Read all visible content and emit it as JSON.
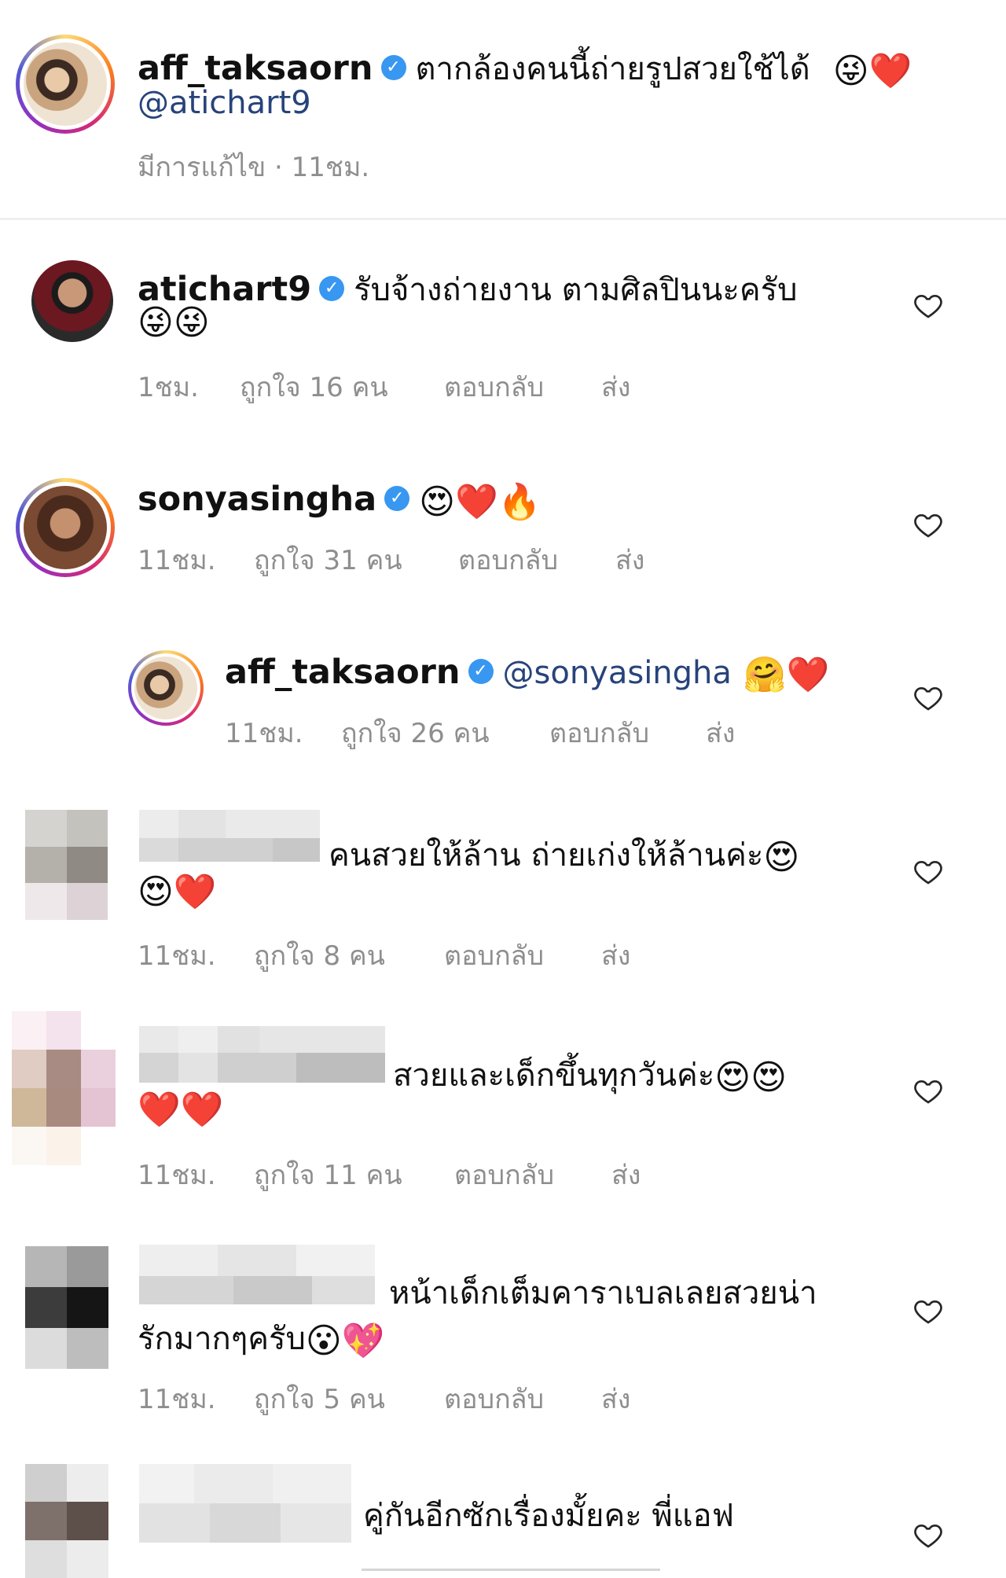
{
  "post": {
    "username": "aff_taksaorn",
    "caption": "ตากล้องคนนี้ถ่ายรูปสวยใช้ได้",
    "caption_emoji": "😜❤️",
    "mention": "@atichart9",
    "meta": "มีการแก้ไข · 11ชม."
  },
  "comments": [
    {
      "username": "atichart9",
      "text": "รับจ้างถ่ายงาน ตามศิลปินนะครับ",
      "emoji_line2": "😜😜",
      "time": "1ชม.",
      "likes": "ถูกใจ 16 คน",
      "reply": "ตอบกลับ",
      "send": "ส่ง"
    },
    {
      "username": "sonyasingha",
      "emoji": "😍❤️🔥",
      "time": "11ชม.",
      "likes": "ถูกใจ 31 คน",
      "reply": "ตอบกลับ",
      "send": "ส่ง"
    },
    {
      "username": "aff_taksaorn",
      "mention": "@sonyasingha",
      "emoji": "🤗❤️",
      "time": "11ชม.",
      "likes": "ถูกใจ 26 คน",
      "reply": "ตอบกลับ",
      "send": "ส่ง"
    },
    {
      "text": "คนสวยให้ล้าน ถ่ายเก่งให้ล้านค่ะ",
      "emoji_end": "😍",
      "emoji_line2": "😍❤️",
      "time": "11ชม.",
      "likes": "ถูกใจ 8 คน",
      "reply": "ตอบกลับ",
      "send": "ส่ง"
    },
    {
      "text": "สวยและเด็กขึ้นทุกวันค่ะ",
      "emoji_end": "😍😍",
      "emoji_line2": "❤️❤️",
      "time": "11ชม.",
      "likes": "ถูกใจ 11 คน",
      "reply": "ตอบกลับ",
      "send": "ส่ง"
    },
    {
      "text": "หน้าเด็กเต็มคาราเบลเลยสวยน่า",
      "text_line2": "รักมากๆครับ",
      "emoji_line2": "😮💖",
      "time": "11ชม.",
      "likes": "ถูกใจ 5 คน",
      "reply": "ตอบกลับ",
      "send": "ส่ง"
    },
    {
      "text": "คู่กันอีกซักเรื่องมั้ยคะ พี่แอฟ"
    }
  ],
  "colors": {
    "verified": "#3897f0",
    "heart_emoji": "#e0245e",
    "meta_text": "#8e8e8e",
    "mention": "#27437a"
  },
  "icons": {
    "verified": "verified-badge-icon",
    "like": "heart-outline-icon"
  }
}
